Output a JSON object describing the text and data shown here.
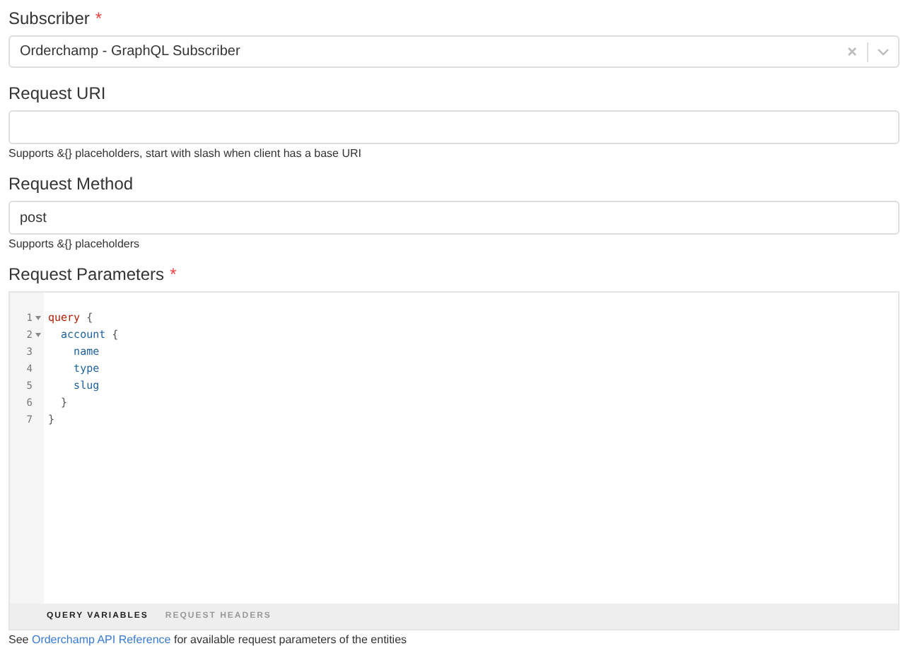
{
  "subscriber": {
    "label": "Subscriber",
    "required_mark": "*",
    "value": "Orderchamp - GraphQL Subscriber"
  },
  "request_uri": {
    "label": "Request URI",
    "hint": "Supports &{} placeholders, start with slash when client has a base URI"
  },
  "request_method": {
    "label": "Request Method",
    "value": "post",
    "hint": "Supports &{} placeholders"
  },
  "request_parameters": {
    "label": "Request Parameters",
    "required_mark": "*",
    "lines": [
      {
        "number": "1",
        "foldable": true,
        "tokens": [
          {
            "text": "query",
            "kind": "keyword"
          },
          {
            "text": " {",
            "kind": "punct"
          }
        ]
      },
      {
        "number": "2",
        "foldable": true,
        "tokens": [
          {
            "text": "  account",
            "kind": "field"
          },
          {
            "text": " {",
            "kind": "punct"
          }
        ]
      },
      {
        "number": "3",
        "foldable": false,
        "tokens": [
          {
            "text": "    name",
            "kind": "field"
          }
        ]
      },
      {
        "number": "4",
        "foldable": false,
        "tokens": [
          {
            "text": "    type",
            "kind": "field"
          }
        ]
      },
      {
        "number": "5",
        "foldable": false,
        "tokens": [
          {
            "text": "    slug",
            "kind": "field"
          }
        ]
      },
      {
        "number": "6",
        "foldable": false,
        "tokens": [
          {
            "text": "  }",
            "kind": "punct"
          }
        ]
      },
      {
        "number": "7",
        "foldable": false,
        "tokens": [
          {
            "text": "}",
            "kind": "punct"
          }
        ]
      }
    ],
    "tabs": [
      {
        "label": "QUERY VARIABLES",
        "selected": true
      },
      {
        "label": "REQUEST HEADERS",
        "selected": false
      }
    ]
  },
  "footer": {
    "before": "See",
    "link": "Orderchamp API Reference",
    "after": "for available request parameters of the entities"
  }
}
